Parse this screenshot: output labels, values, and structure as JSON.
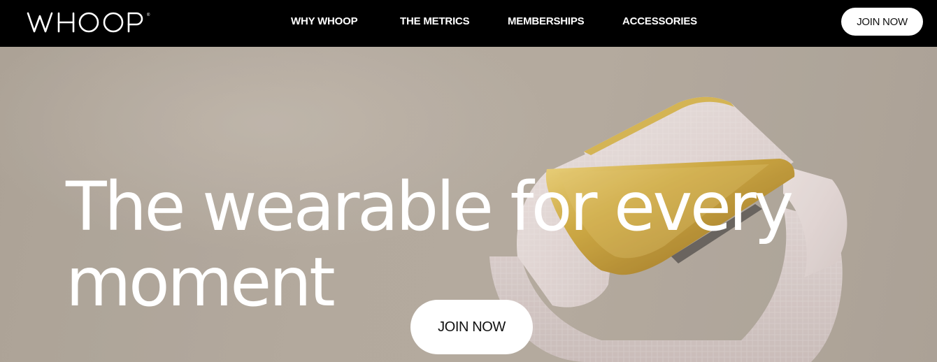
{
  "header": {
    "logo_text": "WHOOP",
    "nav": [
      {
        "label": "WHY WHOOP"
      },
      {
        "label": "THE METRICS"
      },
      {
        "label": "MEMBERSHIPS"
      },
      {
        "label": "ACCESSORIES"
      }
    ],
    "cta_label": "JOIN NOW"
  },
  "hero": {
    "headline_line1": "The wearable for every",
    "headline_line2": "moment",
    "cta_label": "JOIN NOW",
    "colors": {
      "background": "#b3a99e",
      "band": "#e7dcdc",
      "clasp": "#c9a23a"
    }
  }
}
